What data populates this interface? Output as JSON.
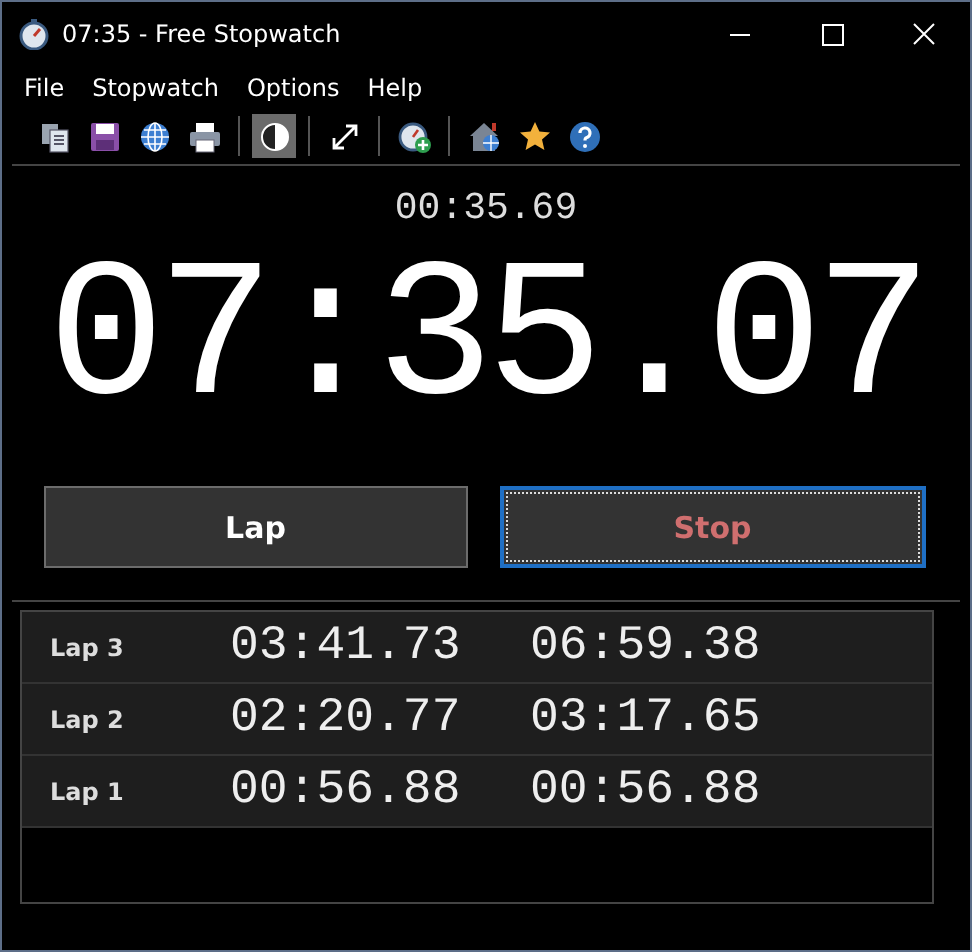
{
  "window": {
    "title": "07:35 - Free Stopwatch"
  },
  "menu": [
    "File",
    "Stopwatch",
    "Options",
    "Help"
  ],
  "toolbar": [
    {
      "kind": "copy",
      "on": false
    },
    {
      "kind": "save",
      "on": false
    },
    {
      "kind": "web",
      "on": false
    },
    {
      "kind": "print",
      "on": false
    },
    {
      "kind": "separator"
    },
    {
      "kind": "contrast",
      "on": true
    },
    {
      "kind": "separator"
    },
    {
      "kind": "fullscreen",
      "on": false
    },
    {
      "kind": "separator"
    },
    {
      "kind": "add-stopwatch",
      "on": false
    },
    {
      "kind": "separator"
    },
    {
      "kind": "home",
      "on": false
    },
    {
      "kind": "star",
      "on": false
    },
    {
      "kind": "help",
      "on": false
    }
  ],
  "lap_time": "00:35.69",
  "main_time": "07:35.07",
  "buttons": [
    {
      "label": "Lap",
      "kind": "lap",
      "focused": false
    },
    {
      "label": "Stop",
      "kind": "stop",
      "focused": true
    }
  ],
  "laps": [
    {
      "label": "Lap 3",
      "split": "03:41.73",
      "total": "06:59.38"
    },
    {
      "label": "Lap 2",
      "split": "02:20.77",
      "total": "03:17.65"
    },
    {
      "label": "Lap 1",
      "split": "00:56.88",
      "total": "00:56.88"
    }
  ]
}
